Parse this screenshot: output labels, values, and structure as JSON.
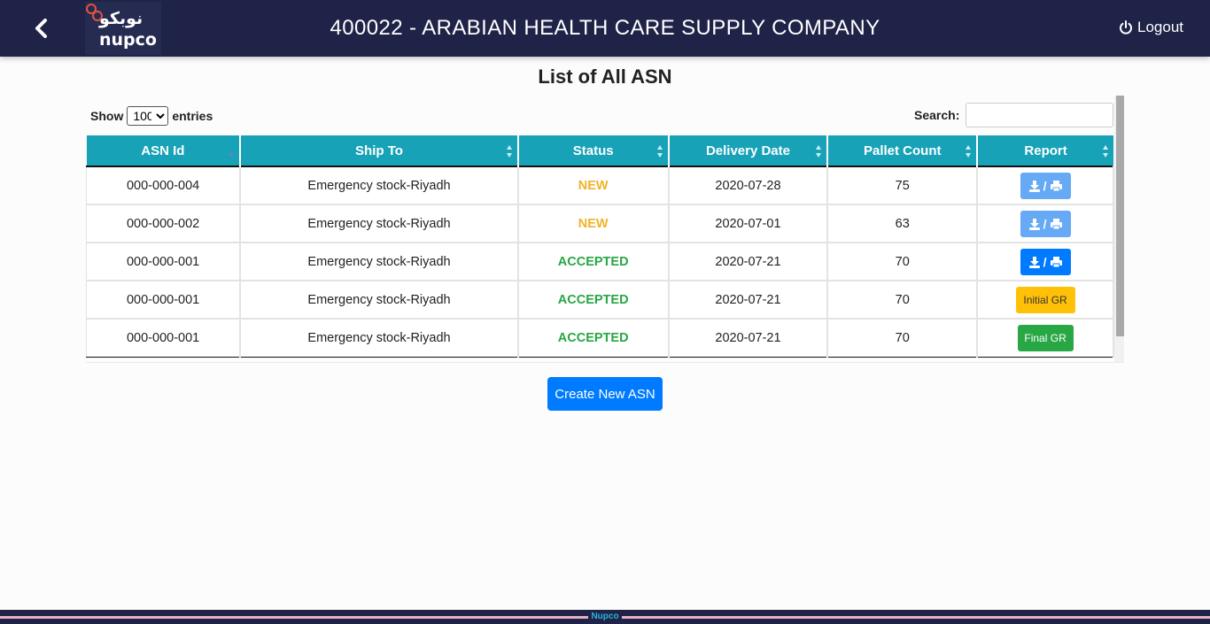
{
  "header": {
    "title": "400022 - ARABIAN HEALTH CARE SUPPLY COMPANY",
    "logo_ar": "نوبكو",
    "logo_en": "nupco",
    "logout_label": "Logout",
    "back_icon": "chevron-left-icon",
    "logout_icon": "power-icon"
  },
  "page": {
    "title": "List of All ASN"
  },
  "controls": {
    "show_label": "Show",
    "page_size": "100",
    "entries_label": "entries",
    "search_label": "Search:",
    "search_value": ""
  },
  "table": {
    "columns": [
      "ASN Id",
      "Ship To",
      "Status",
      "Delivery Date",
      "Pallet Count",
      "Report"
    ],
    "rows": [
      {
        "asn_id": "000-000-004",
        "ship_to": "Emergency stock-Riyadh",
        "status": "NEW",
        "delivery_date": "2020-07-28",
        "pallet_count": "75",
        "report": "download-print-light"
      },
      {
        "asn_id": "000-000-002",
        "ship_to": "Emergency stock-Riyadh",
        "status": "NEW",
        "delivery_date": "2020-07-01",
        "pallet_count": "63",
        "report": "download-print-light"
      },
      {
        "asn_id": "000-000-001",
        "ship_to": "Emergency stock-Riyadh",
        "status": "ACCEPTED",
        "delivery_date": "2020-07-21",
        "pallet_count": "70",
        "report": "download-print-dark"
      },
      {
        "asn_id": "000-000-001",
        "ship_to": "Emergency stock-Riyadh",
        "status": "ACCEPTED",
        "delivery_date": "2020-07-21",
        "pallet_count": "70",
        "report": "Initial GR"
      },
      {
        "asn_id": "000-000-001",
        "ship_to": "Emergency stock-Riyadh",
        "status": "ACCEPTED",
        "delivery_date": "2020-07-21",
        "pallet_count": "70",
        "report": "Final GR"
      }
    ],
    "report_separator": "/"
  },
  "actions": {
    "create_label": "Create New ASN"
  },
  "footer": {
    "text": "Nupco"
  },
  "colors": {
    "header_bg": "#1e2347",
    "table_header": "#17a2b8",
    "status_new": "#f0b429",
    "status_accepted": "#28a745",
    "primary": "#007bff"
  }
}
